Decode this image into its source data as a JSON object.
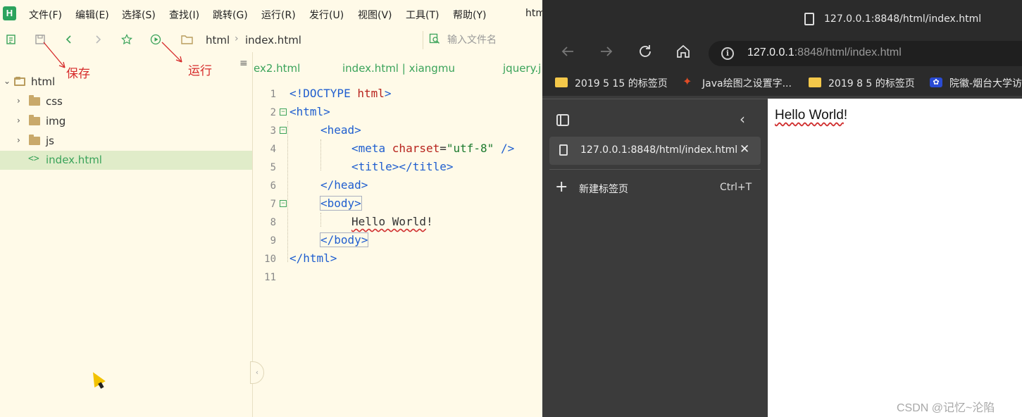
{
  "editor": {
    "logo": "H",
    "menu": [
      "文件(F)",
      "编辑(E)",
      "选择(S)",
      "查找(I)",
      "跳转(G)",
      "运行(R)",
      "发行(U)",
      "视图(V)",
      "工具(T)",
      "帮助(Y)"
    ],
    "window_title_clip": "htm",
    "breadcrumb": [
      "html",
      "index.html"
    ],
    "search_placeholder": "输入文件名",
    "annotations": {
      "save": "保存",
      "run": "运行"
    },
    "tree": [
      {
        "label": "html",
        "kind": "folder-open",
        "level": 0
      },
      {
        "label": "css",
        "kind": "folder",
        "level": 1
      },
      {
        "label": "img",
        "kind": "folder",
        "level": 1
      },
      {
        "label": "js",
        "kind": "folder",
        "level": 1
      },
      {
        "label": "index.html",
        "kind": "file",
        "level": 1,
        "selected": true
      }
    ],
    "tabs": [
      "ex2.html",
      "index.html | xiangmu",
      "jquery.j"
    ],
    "line_numbers": [
      "1",
      "2",
      "3",
      "4",
      "5",
      "6",
      "7",
      "8",
      "9",
      "10",
      "11"
    ],
    "code": {
      "doctype": "<!DOCTYPE ",
      "doctype_kw": "html",
      "doctype_end": ">",
      "html_open": "<html>",
      "head_open": "<head>",
      "meta_open": "<meta ",
      "meta_attr": "charset",
      "meta_eq": "=",
      "meta_val": "\"utf-8\"",
      "meta_end": " />",
      "title": "<title></title>",
      "head_close": "</head>",
      "body_open": "<body>",
      "hello": "Hello World",
      "bang": "!",
      "body_close": "</body>",
      "html_close": "</html>"
    }
  },
  "browser": {
    "title": "127.0.0.1:8848/html/index.html",
    "address": {
      "host": "127.0.0.1",
      "rest": ":8848/html/index.html"
    },
    "bookmarks": [
      {
        "icon": "folder-icon",
        "label": "2019 5 15 的标签页"
      },
      {
        "icon": "java-icon",
        "label": "Java绘图之设置字..."
      },
      {
        "icon": "folder-icon",
        "label": "2019 8 5 的标签页"
      },
      {
        "icon": "paw-icon",
        "label": "院徽-烟台大学访"
      }
    ],
    "vertical_tab": "127.0.0.1:8848/html/index.html",
    "new_tab_label": "新建标签页",
    "new_tab_shortcut": "Ctrl+T",
    "page_text": "Hello World",
    "page_bang": "!"
  },
  "watermark": "CSDN @记忆~沦陷",
  "colors": {
    "editor_bg": "#fffae8",
    "accent": "#3aa35a",
    "browser_dark": "#2b2b2b",
    "annotation_red": "#d62b2b"
  }
}
